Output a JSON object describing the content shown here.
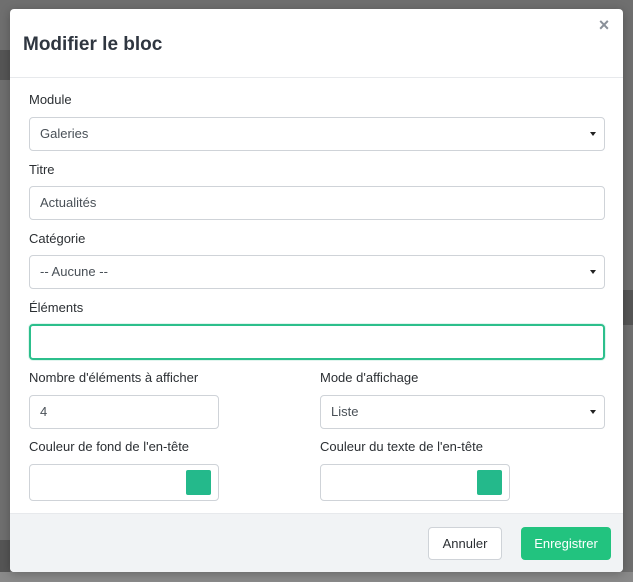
{
  "modal": {
    "title": "Modifier le bloc",
    "close_label": "×"
  },
  "form": {
    "module": {
      "label": "Module",
      "value": "Galeries"
    },
    "titre": {
      "label": "Titre",
      "value": "Actualités"
    },
    "categorie": {
      "label": "Catégorie",
      "value": "-- Aucune --"
    },
    "elements": {
      "label": "Éléments",
      "value": ""
    },
    "nombre": {
      "label": "Nombre d'éléments à afficher",
      "value": "4"
    },
    "mode": {
      "label": "Mode d'affichage",
      "value": "Liste"
    },
    "couleur_fond": {
      "label": "Couleur de fond de l'en-tête",
      "color": "#24b98b"
    },
    "couleur_texte": {
      "label": "Couleur du texte de l'en-tête",
      "color": "#24b98b"
    }
  },
  "footer": {
    "cancel_label": "Annuler",
    "save_label": "Enregistrer"
  },
  "colors": {
    "accent": "#22c37f",
    "focus_border": "#2cbf8c"
  }
}
